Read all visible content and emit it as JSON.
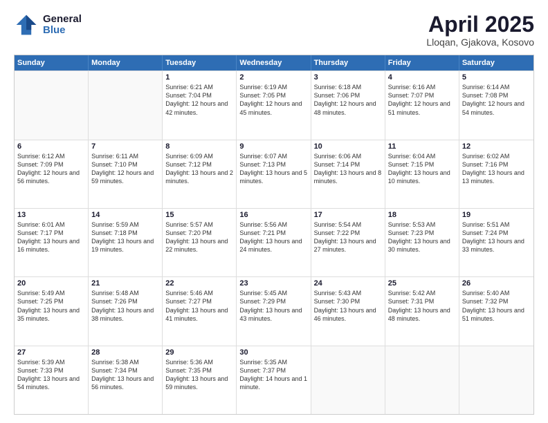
{
  "logo": {
    "general": "General",
    "blue": "Blue"
  },
  "title": {
    "month": "April 2025",
    "location": "Lloqan, Gjakova, Kosovo"
  },
  "days_header": [
    "Sunday",
    "Monday",
    "Tuesday",
    "Wednesday",
    "Thursday",
    "Friday",
    "Saturday"
  ],
  "weeks": [
    [
      {
        "day": "",
        "text": ""
      },
      {
        "day": "",
        "text": ""
      },
      {
        "day": "1",
        "text": "Sunrise: 6:21 AM\nSunset: 7:04 PM\nDaylight: 12 hours and 42 minutes."
      },
      {
        "day": "2",
        "text": "Sunrise: 6:19 AM\nSunset: 7:05 PM\nDaylight: 12 hours and 45 minutes."
      },
      {
        "day": "3",
        "text": "Sunrise: 6:18 AM\nSunset: 7:06 PM\nDaylight: 12 hours and 48 minutes."
      },
      {
        "day": "4",
        "text": "Sunrise: 6:16 AM\nSunset: 7:07 PM\nDaylight: 12 hours and 51 minutes."
      },
      {
        "day": "5",
        "text": "Sunrise: 6:14 AM\nSunset: 7:08 PM\nDaylight: 12 hours and 54 minutes."
      }
    ],
    [
      {
        "day": "6",
        "text": "Sunrise: 6:12 AM\nSunset: 7:09 PM\nDaylight: 12 hours and 56 minutes."
      },
      {
        "day": "7",
        "text": "Sunrise: 6:11 AM\nSunset: 7:10 PM\nDaylight: 12 hours and 59 minutes."
      },
      {
        "day": "8",
        "text": "Sunrise: 6:09 AM\nSunset: 7:12 PM\nDaylight: 13 hours and 2 minutes."
      },
      {
        "day": "9",
        "text": "Sunrise: 6:07 AM\nSunset: 7:13 PM\nDaylight: 13 hours and 5 minutes."
      },
      {
        "day": "10",
        "text": "Sunrise: 6:06 AM\nSunset: 7:14 PM\nDaylight: 13 hours and 8 minutes."
      },
      {
        "day": "11",
        "text": "Sunrise: 6:04 AM\nSunset: 7:15 PM\nDaylight: 13 hours and 10 minutes."
      },
      {
        "day": "12",
        "text": "Sunrise: 6:02 AM\nSunset: 7:16 PM\nDaylight: 13 hours and 13 minutes."
      }
    ],
    [
      {
        "day": "13",
        "text": "Sunrise: 6:01 AM\nSunset: 7:17 PM\nDaylight: 13 hours and 16 minutes."
      },
      {
        "day": "14",
        "text": "Sunrise: 5:59 AM\nSunset: 7:18 PM\nDaylight: 13 hours and 19 minutes."
      },
      {
        "day": "15",
        "text": "Sunrise: 5:57 AM\nSunset: 7:20 PM\nDaylight: 13 hours and 22 minutes."
      },
      {
        "day": "16",
        "text": "Sunrise: 5:56 AM\nSunset: 7:21 PM\nDaylight: 13 hours and 24 minutes."
      },
      {
        "day": "17",
        "text": "Sunrise: 5:54 AM\nSunset: 7:22 PM\nDaylight: 13 hours and 27 minutes."
      },
      {
        "day": "18",
        "text": "Sunrise: 5:53 AM\nSunset: 7:23 PM\nDaylight: 13 hours and 30 minutes."
      },
      {
        "day": "19",
        "text": "Sunrise: 5:51 AM\nSunset: 7:24 PM\nDaylight: 13 hours and 33 minutes."
      }
    ],
    [
      {
        "day": "20",
        "text": "Sunrise: 5:49 AM\nSunset: 7:25 PM\nDaylight: 13 hours and 35 minutes."
      },
      {
        "day": "21",
        "text": "Sunrise: 5:48 AM\nSunset: 7:26 PM\nDaylight: 13 hours and 38 minutes."
      },
      {
        "day": "22",
        "text": "Sunrise: 5:46 AM\nSunset: 7:27 PM\nDaylight: 13 hours and 41 minutes."
      },
      {
        "day": "23",
        "text": "Sunrise: 5:45 AM\nSunset: 7:29 PM\nDaylight: 13 hours and 43 minutes."
      },
      {
        "day": "24",
        "text": "Sunrise: 5:43 AM\nSunset: 7:30 PM\nDaylight: 13 hours and 46 minutes."
      },
      {
        "day": "25",
        "text": "Sunrise: 5:42 AM\nSunset: 7:31 PM\nDaylight: 13 hours and 48 minutes."
      },
      {
        "day": "26",
        "text": "Sunrise: 5:40 AM\nSunset: 7:32 PM\nDaylight: 13 hours and 51 minutes."
      }
    ],
    [
      {
        "day": "27",
        "text": "Sunrise: 5:39 AM\nSunset: 7:33 PM\nDaylight: 13 hours and 54 minutes."
      },
      {
        "day": "28",
        "text": "Sunrise: 5:38 AM\nSunset: 7:34 PM\nDaylight: 13 hours and 56 minutes."
      },
      {
        "day": "29",
        "text": "Sunrise: 5:36 AM\nSunset: 7:35 PM\nDaylight: 13 hours and 59 minutes."
      },
      {
        "day": "30",
        "text": "Sunrise: 5:35 AM\nSunset: 7:37 PM\nDaylight: 14 hours and 1 minute."
      },
      {
        "day": "",
        "text": ""
      },
      {
        "day": "",
        "text": ""
      },
      {
        "day": "",
        "text": ""
      }
    ]
  ]
}
